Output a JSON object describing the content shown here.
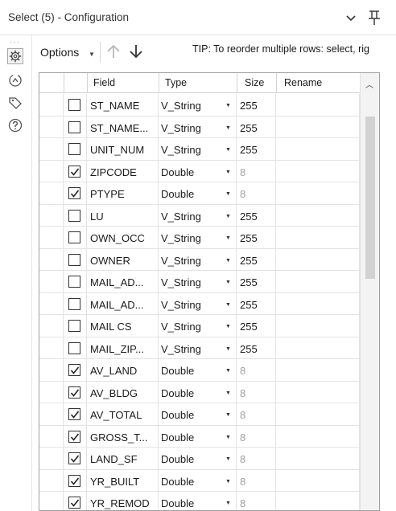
{
  "window": {
    "title": "Select (5) - Configuration"
  },
  "toolbar": {
    "options_label": "Options",
    "tip": "TIP: To reorder multiple rows: select, rig"
  },
  "grid": {
    "columns": [
      "Field",
      "Type",
      "Size",
      "Rename"
    ],
    "rows": [
      {
        "checked": false,
        "field": "ST_NAME",
        "type": "V_String",
        "size": "255",
        "size_dim": false,
        "rename": ""
      },
      {
        "checked": false,
        "field": "ST_NAME...",
        "type": "V_String",
        "size": "255",
        "size_dim": false,
        "rename": ""
      },
      {
        "checked": false,
        "field": "UNIT_NUM",
        "type": "V_String",
        "size": "255",
        "size_dim": false,
        "rename": ""
      },
      {
        "checked": true,
        "field": "ZIPCODE",
        "type": "Double",
        "size": "8",
        "size_dim": true,
        "rename": ""
      },
      {
        "checked": true,
        "field": "PTYPE",
        "type": "Double",
        "size": "8",
        "size_dim": true,
        "rename": ""
      },
      {
        "checked": false,
        "field": "LU",
        "type": "V_String",
        "size": "255",
        "size_dim": false,
        "rename": ""
      },
      {
        "checked": false,
        "field": "OWN_OCC",
        "type": "V_String",
        "size": "255",
        "size_dim": false,
        "rename": ""
      },
      {
        "checked": false,
        "field": "OWNER",
        "type": "V_String",
        "size": "255",
        "size_dim": false,
        "rename": ""
      },
      {
        "checked": false,
        "field": "MAIL_AD...",
        "type": "V_String",
        "size": "255",
        "size_dim": false,
        "rename": ""
      },
      {
        "checked": false,
        "field": "MAIL_AD...",
        "type": "V_String",
        "size": "255",
        "size_dim": false,
        "rename": ""
      },
      {
        "checked": false,
        "field": "MAIL CS",
        "type": "V_String",
        "size": "255",
        "size_dim": false,
        "rename": ""
      },
      {
        "checked": false,
        "field": "MAIL_ZIP...",
        "type": "V_String",
        "size": "255",
        "size_dim": false,
        "rename": ""
      },
      {
        "checked": true,
        "field": "AV_LAND",
        "type": "Double",
        "size": "8",
        "size_dim": true,
        "rename": ""
      },
      {
        "checked": true,
        "field": "AV_BLDG",
        "type": "Double",
        "size": "8",
        "size_dim": true,
        "rename": ""
      },
      {
        "checked": true,
        "field": "AV_TOTAL",
        "type": "Double",
        "size": "8",
        "size_dim": true,
        "rename": ""
      },
      {
        "checked": true,
        "field": "GROSS_T...",
        "type": "Double",
        "size": "8",
        "size_dim": true,
        "rename": ""
      },
      {
        "checked": true,
        "field": "LAND_SF",
        "type": "Double",
        "size": "8",
        "size_dim": true,
        "rename": ""
      },
      {
        "checked": true,
        "field": "YR_BUILT",
        "type": "Double",
        "size": "8",
        "size_dim": true,
        "rename": ""
      },
      {
        "checked": true,
        "field": "YR_REMOD",
        "type": "Double",
        "size": "8",
        "size_dim": true,
        "rename": ""
      },
      {
        "checked": true,
        "field": "",
        "type": "",
        "size": "",
        "size_dim": true,
        "rename": ""
      }
    ]
  },
  "icons": {
    "title_right": [
      "chevron-down-icon",
      "pin-icon"
    ],
    "side": [
      "gear-icon",
      "navigate-icon",
      "tag-icon",
      "help-icon"
    ],
    "toolbar": [
      "move-up-icon",
      "move-down-icon"
    ]
  },
  "colors": {
    "border": "#a0a0a0",
    "dim_text": "#a0a0a0"
  }
}
